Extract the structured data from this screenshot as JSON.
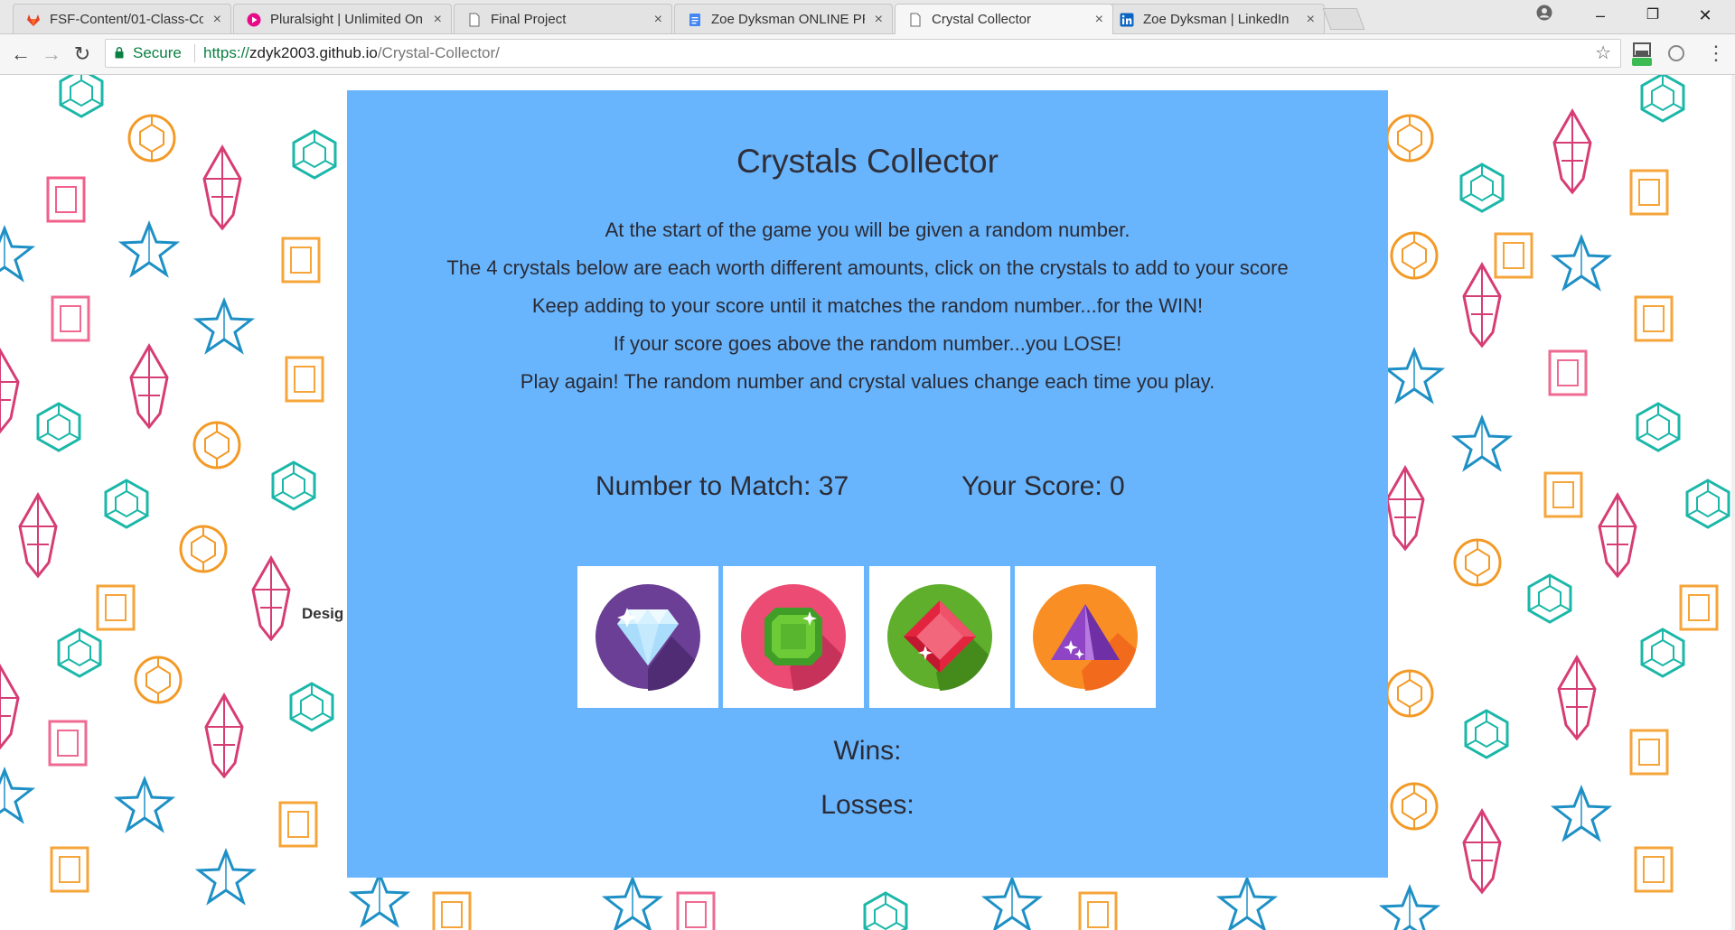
{
  "tabs": [
    {
      "title": "FSF-Content/01-Class-Co",
      "icon": "gitlab-icon",
      "active": false
    },
    {
      "title": "Pluralsight | Unlimited On",
      "icon": "pluralsight-icon",
      "active": false
    },
    {
      "title": "Final Project",
      "icon": "page-icon",
      "active": false
    },
    {
      "title": "Zoe Dyksman ONLINE PR",
      "icon": "docs-icon",
      "active": false
    },
    {
      "title": "Crystal Collector",
      "icon": "page-icon",
      "active": true
    },
    {
      "title": "Zoe Dyksman | LinkedIn",
      "icon": "linkedin-icon",
      "active": false
    }
  ],
  "window_controls": {
    "minimize": "–",
    "restore": "❐",
    "close": "✕"
  },
  "toolbar": {
    "back": "←",
    "forward": "→",
    "reload": "↻",
    "secure_label": "Secure",
    "url_scheme": "https://",
    "url_host": "zdyk2003.github.io",
    "url_path": "/Crystal-Collector/",
    "star": "☆",
    "menu": "⋮"
  },
  "page": {
    "design_label": "Desig",
    "title": "Crystals Collector",
    "instructions": [
      "At the start of the game you will be given a random number.",
      "The 4 crystals below are each worth different amounts, click on the crystals to add to your score",
      "Keep adding to your score until it matches the random number...for the WIN!",
      "If your score goes above the random number...you LOSE!",
      "Play again! The random number and crystal values change each time you play."
    ],
    "number_to_match_label": "Number to Match:",
    "number_to_match": "37",
    "your_score_label": "Your Score:",
    "your_score": "0",
    "wins_label": "Wins:",
    "wins_value": "",
    "losses_label": "Losses:",
    "losses_value": ""
  },
  "crystals": [
    {
      "name": "diamond-crystal-icon",
      "bg": "#6a3f95"
    },
    {
      "name": "emerald-crystal-icon",
      "bg": "#ec4b73"
    },
    {
      "name": "ruby-crystal-icon",
      "bg": "#5fae2c"
    },
    {
      "name": "amethyst-crystal-icon",
      "bg": "#f98f24"
    }
  ],
  "colors": {
    "panel": "#68b5fd",
    "secure_green": "#0b8043"
  }
}
